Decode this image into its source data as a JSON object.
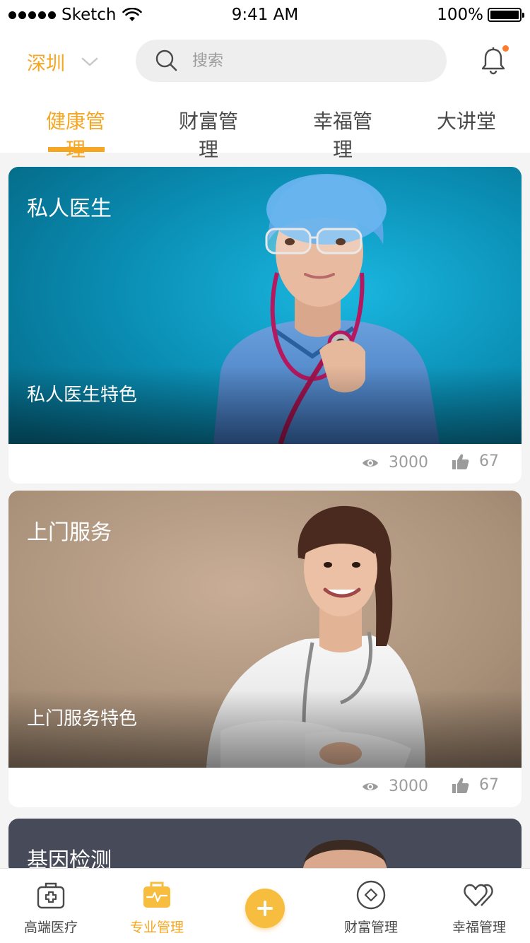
{
  "status_bar": {
    "carrier": "Sketch",
    "time": "9:41 AM",
    "battery": "100%"
  },
  "header": {
    "city": "深圳",
    "search_placeholder": "搜索",
    "has_notification": true
  },
  "tabs": [
    {
      "label": "健康管理",
      "active": true
    },
    {
      "label": "财富管理",
      "active": false
    },
    {
      "label": "幸福管理",
      "active": false
    },
    {
      "label": "大讲堂",
      "active": false
    }
  ],
  "cards": [
    {
      "title": "私人医生",
      "subtitle": "私人医生特色",
      "views": "3000",
      "likes": "67",
      "image": "doctor-with-stethoscope-photo"
    },
    {
      "title": "上门服务",
      "subtitle": "上门服务特色",
      "views": "3000",
      "likes": "67",
      "image": "smiling-female-doctor-photo"
    },
    {
      "title": "基因检测",
      "subtitle": "",
      "views": "",
      "likes": "",
      "image": "male-doctor-photo"
    }
  ],
  "tab_bar": {
    "items": [
      {
        "label": "高端医疗",
        "icon": "medical-kit-icon",
        "active": false
      },
      {
        "label": "专业管理",
        "icon": "heartbeat-bag-icon",
        "active": true
      },
      {
        "label": "",
        "icon": "add-icon",
        "active": false
      },
      {
        "label": "财富管理",
        "icon": "diamond-icon",
        "active": false
      },
      {
        "label": "幸福管理",
        "icon": "hearts-icon",
        "active": false
      }
    ]
  },
  "colors": {
    "accent": "#f5a623",
    "text": "#4a4a4a",
    "muted": "#9b9b9b",
    "notification_dot": "#ff7a2b"
  }
}
